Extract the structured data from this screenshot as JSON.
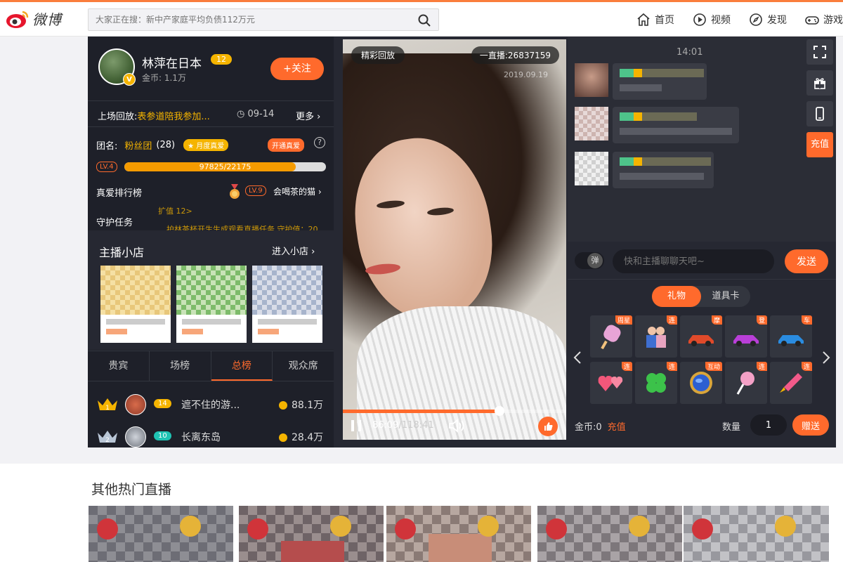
{
  "header": {
    "logo_text": "微博",
    "search_placeholder": "大家正在搜：新中产家庭平均负债112万元",
    "nav": [
      {
        "label": "首页",
        "icon": "home-icon"
      },
      {
        "label": "视频",
        "icon": "video-icon"
      },
      {
        "label": "发现",
        "icon": "compass-icon"
      },
      {
        "label": "游戏",
        "icon": "gamepad-icon"
      }
    ]
  },
  "host": {
    "name": "林萍在日本",
    "level": "12",
    "coins": "金币: 1.1万",
    "follow_label": "+关注"
  },
  "replay": {
    "label": "上场回放:",
    "title": "表参道陪我参加...",
    "date": "09-14",
    "more": "更多 ›"
  },
  "fanclub": {
    "group_label": "团名:",
    "group_name": "粉丝团",
    "group_count": "(28)",
    "tag": "月度真爱",
    "open_label": "开通真爱",
    "level": "LV.4",
    "progress_text": "97825/22175",
    "progress_fraction": 0.85,
    "rank_label": "真爱排行榜",
    "rank_level": "LV.9",
    "rank_name": "会喝茶的猫 ›",
    "guard_label": "守护任务",
    "guard_scroll1": "扩值 12>",
    "guard_scroll2": "护林茶杯开生生成观看直播任务,守护值：20"
  },
  "shop": {
    "title": "主播小店",
    "enter": "进入小店 ›"
  },
  "tabs": [
    {
      "label": "贵宾",
      "active": false
    },
    {
      "label": "场榜",
      "active": false
    },
    {
      "label": "总榜",
      "active": true
    },
    {
      "label": "观众席",
      "active": false
    }
  ],
  "ranking": [
    {
      "rank": "1",
      "level": "14",
      "level_color": "#f5b400",
      "name": "遮不住的游...",
      "amount": "88.1万"
    },
    {
      "rank": "2",
      "level": "10",
      "level_color": "#1fc4b4",
      "name": "长离东岛",
      "amount": "28.4万"
    }
  ],
  "video": {
    "badge_left": "精彩回放",
    "badge_right": "一直播:26837159",
    "stamp": "2019.09.19",
    "time_current": "86:09",
    "time_total": "/118:41",
    "played_fraction": 0.7
  },
  "chat": {
    "time": "14:01",
    "recharge": "充值",
    "danmu": "弹",
    "placeholder": "快和主播聊聊天吧~",
    "send": "发送"
  },
  "gifts": {
    "tabs": [
      {
        "label": "礼物",
        "active": true
      },
      {
        "label": "道具卡",
        "active": false
      }
    ],
    "items": [
      {
        "name": "popsicle-gift",
        "tag": "周星"
      },
      {
        "name": "couple-gift",
        "tag": "连"
      },
      {
        "name": "sports-car-gift",
        "tag": "摩"
      },
      {
        "name": "purple-car-gift",
        "tag": "登"
      },
      {
        "name": "blue-car-gift",
        "tag": "车"
      },
      {
        "name": "hearts-gift",
        "tag": "连"
      },
      {
        "name": "clover-gift",
        "tag": "连"
      },
      {
        "name": "globe-gift",
        "tag": "互动"
      },
      {
        "name": "lollipop-gift",
        "tag": "连"
      },
      {
        "name": "rocket-gift",
        "tag": "连"
      }
    ],
    "coins": "金币:0",
    "charge": "充值",
    "qty_label": "数量",
    "qty_value": "1",
    "give": "赠送"
  },
  "bottom": {
    "title": "其他热门直播"
  },
  "colors": {
    "accent": "#ff6a2c",
    "gold": "#f5b400",
    "panel": "#1e2029"
  }
}
